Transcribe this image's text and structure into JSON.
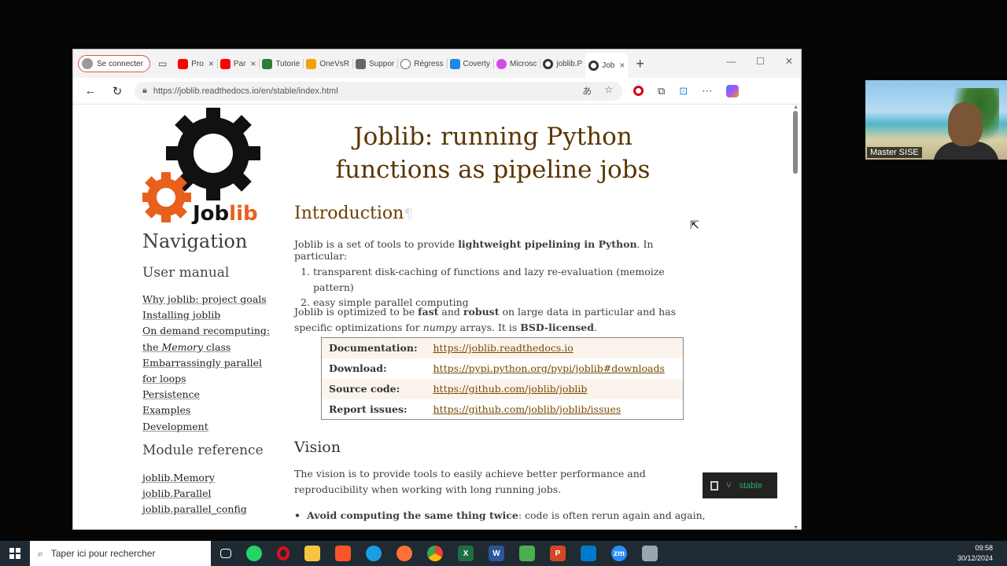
{
  "browser": {
    "profile_label": "Se connecter",
    "tabs": [
      {
        "label": "Pro",
        "color": "#ff0000"
      },
      {
        "label": "Par",
        "color": "#ff0000"
      },
      {
        "label": "Tutorie",
        "color": "#2e7d32"
      },
      {
        "label": "OneVsR",
        "color": "#f59e0b"
      },
      {
        "label": "Suppor",
        "color": "#666666"
      },
      {
        "label": "Régress",
        "color": "#888888"
      },
      {
        "label": "Coverty",
        "color": "#1e88e5"
      },
      {
        "label": "Microsc",
        "color": "#d946ef"
      },
      {
        "label": "joblib.P",
        "color": "#333333"
      },
      {
        "label": "Job",
        "color": "#333333"
      }
    ],
    "url": "https://joblib.readthedocs.io/en/stable/index.html"
  },
  "sidebar": {
    "logo_text": "Joblib",
    "nav_heading": "Navigation",
    "user_manual_heading": "User manual",
    "user_manual_links": [
      "Why joblib: project goals",
      "Installing joblib",
      "On demand recomputing:",
      "the Memory class",
      "Embarrassingly parallel",
      "for loops",
      "Persistence",
      "Examples",
      "Development"
    ],
    "module_ref_heading": "Module reference",
    "module_links": [
      "joblib.Memory",
      "joblib.Parallel",
      "joblib.parallel_config"
    ]
  },
  "main": {
    "title_line1": "Joblib: running Python",
    "title_line2": "functions as pipeline jobs",
    "intro_heading": "Introduction",
    "pilcrow": "¶",
    "p1_a": "Joblib is a set of tools to provide ",
    "p1_b": "lightweight pipelining in Python",
    "p1_c": ". In particular:",
    "list": [
      "transparent disk-caching of functions and lazy re-evaluation (memoize pattern)",
      "easy simple parallel computing"
    ],
    "p2_a": "Joblib is optimized to be ",
    "p2_b": "fast",
    "p2_c": " and ",
    "p2_d": "robust",
    "p2_e": " on large data in particular and has specific optimizations for ",
    "p2_f": "numpy",
    "p2_g": " arrays. It is ",
    "p2_h": "BSD-licensed",
    "p2_i": ".",
    "info_rows": [
      {
        "key": "Documentation:",
        "value": "https://joblib.readthedocs.io"
      },
      {
        "key": "Download:",
        "value": "https://pypi.python.org/pypi/joblib#downloads"
      },
      {
        "key": "Source code:",
        "value": "https://github.com/joblib/joblib"
      },
      {
        "key": "Report issues:",
        "value": "https://github.com/joblib/joblib/issues"
      }
    ],
    "vision_heading": "Vision",
    "p3": "The vision is to provide tools to easily achieve better performance and reproducibility when working with long running jobs.",
    "p4_b": "Avoid computing the same thing twice",
    "p4_rest": ": code is often rerun again and again,"
  },
  "rtd_badge": {
    "label": "stable"
  },
  "webcam": {
    "label": "Master SISE"
  },
  "taskbar": {
    "search_placeholder": "Taper ici pour rechercher",
    "time": "09:58",
    "date": "30/12/2024"
  }
}
